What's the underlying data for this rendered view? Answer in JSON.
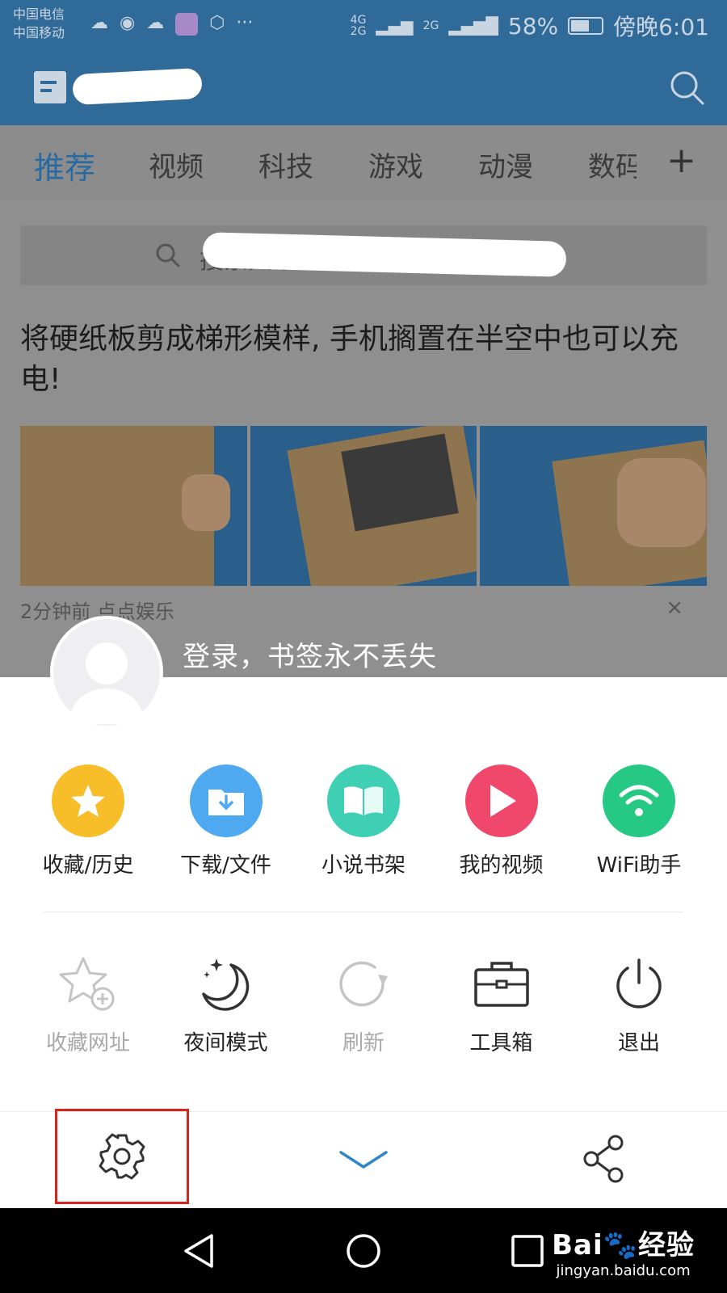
{
  "status_bar": {
    "carrier_1": "中国电信",
    "carrier_2": "中国移动",
    "notif_icons": [
      "weather-icon",
      "wechat-icon",
      "cloud-icon",
      "app-icon",
      "shield-icon"
    ],
    "more": "···",
    "net_1": "4G",
    "net_2": "2G",
    "net_3": "2G",
    "battery": "58%",
    "time": "傍晚6:01"
  },
  "header": {
    "logo_icon": "news-icon",
    "search_icon": "search-icon"
  },
  "tabs": [
    {
      "label": "推荐",
      "active": true
    },
    {
      "label": "视频"
    },
    {
      "label": "科技"
    },
    {
      "label": "游戏"
    },
    {
      "label": "动漫"
    },
    {
      "label": "数码"
    }
  ],
  "tab_add": "+",
  "search": {
    "placeholder": "搜索文章、兴趣号、兴趣标签"
  },
  "article": {
    "headline": "将硬纸板剪成梯形模样, 手机搁置在半空中也可以充电!",
    "meta": "2分钟前  点点娱乐",
    "close": "×"
  },
  "sheet": {
    "login_prompt": "登录，书签永不丢失",
    "features": [
      {
        "label": "收藏/历史",
        "icon": "star-icon",
        "color": "#f7be2a"
      },
      {
        "label": "下载/文件",
        "icon": "folder-download-icon",
        "color": "#4ea9f1"
      },
      {
        "label": "小说书架",
        "icon": "book-icon",
        "color": "#3fcfb4"
      },
      {
        "label": "我的视频",
        "icon": "play-icon",
        "color": "#f0486a"
      },
      {
        "label": "WiFi助手",
        "icon": "wifi-icon",
        "color": "#25c984"
      }
    ],
    "actions": [
      {
        "label": "收藏网址",
        "icon": "add-bookmark-icon",
        "enabled": false
      },
      {
        "label": "夜间模式",
        "icon": "moon-icon",
        "enabled": true
      },
      {
        "label": "刷新",
        "icon": "refresh-icon",
        "enabled": false
      },
      {
        "label": "工具箱",
        "icon": "toolbox-icon",
        "enabled": true
      },
      {
        "label": "退出",
        "icon": "power-icon",
        "enabled": true
      }
    ],
    "footer": {
      "settings_icon": "gear-icon",
      "collapse_icon": "chevron-down-icon",
      "share_icon": "share-icon",
      "highlight_color": "#d9231d"
    }
  },
  "nav_bar": {
    "back_icon": "back-icon",
    "home_icon": "home-icon",
    "recent_icon": "recent-apps-icon"
  },
  "watermark": {
    "brand": "Bai",
    "brand_suffix": "经验",
    "url": "jingyan.baidu.com"
  }
}
